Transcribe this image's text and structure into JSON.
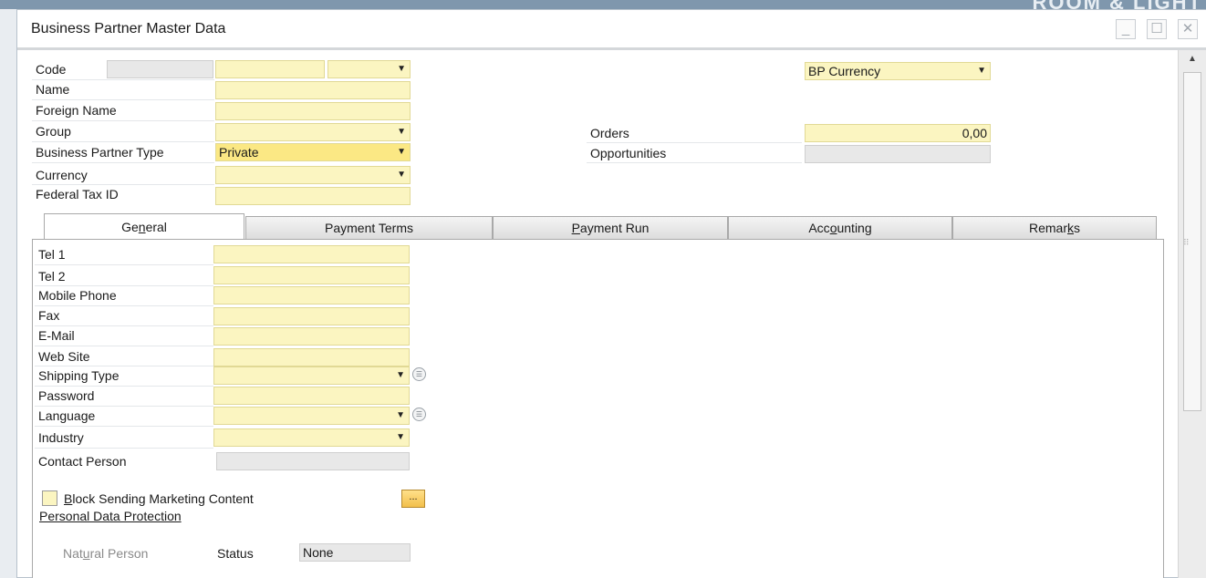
{
  "background": {
    "brand_text": "ROOM & LIGHT"
  },
  "window": {
    "title": "Business Partner Master Data",
    "buttons": {
      "minimize": "_",
      "maximize": "☐",
      "close": "✕"
    }
  },
  "header": {
    "code_label": "Code",
    "name_label": "Name",
    "foreign_name_label": "Foreign Name",
    "group_label": "Group",
    "bp_type_label": "Business Partner Type",
    "bp_type_value": "Private",
    "currency_label": "Currency",
    "tax_id_label": "Federal Tax ID",
    "bp_currency_value": "BP Currency",
    "orders_label": "Orders",
    "orders_value": "0,00",
    "opportunities_label": "Opportunities"
  },
  "tabs": [
    {
      "pre": "Ge",
      "key": "n",
      "post": "eral",
      "active": true
    },
    {
      "pre": "Payment Terms",
      "key": "",
      "post": "",
      "active": false
    },
    {
      "pre": "",
      "key": "P",
      "post": "ayment Run",
      "active": false
    },
    {
      "pre": "Acc",
      "key": "o",
      "post": "unting",
      "active": false
    },
    {
      "pre": "Remar",
      "key": "k",
      "post": "s",
      "active": false
    }
  ],
  "general": {
    "tel1": "Tel 1",
    "tel2": "Tel 2",
    "mobile": "Mobile Phone",
    "fax": "Fax",
    "email": "E-Mail",
    "website": "Web Site",
    "shipping_type": "Shipping Type",
    "password": "Password",
    "language": "Language",
    "industry": "Industry",
    "contact_person": "Contact Person",
    "block_marketing_key": "B",
    "block_marketing_rest": "lock Sending Marketing Content",
    "personal_data_protection": "Personal Data Protection",
    "more_button": "...",
    "natural_person_pre": "Nat",
    "natural_person_key": "u",
    "natural_person_post": "ral Person",
    "status_label": "Status",
    "status_value": "None"
  },
  "icons": {
    "dropdown": "▼",
    "info": "☰",
    "scroll_up": "▲",
    "grip": "⠿"
  },
  "colors": {
    "field_yellow": "#fbf5c1",
    "field_gray": "#e8e8e8",
    "button_orange": "#f2bf4b"
  }
}
